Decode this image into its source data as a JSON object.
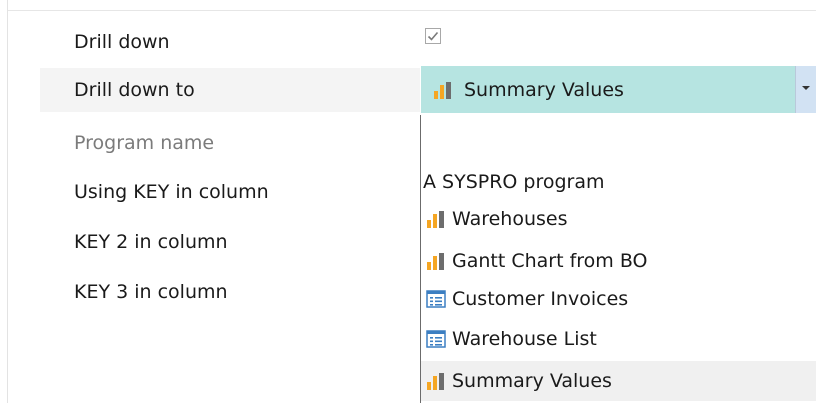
{
  "properties": [
    {
      "label": "Drill down",
      "disabled": false
    },
    {
      "label": "Drill down to",
      "disabled": false
    },
    {
      "label": "Program name",
      "disabled": true
    },
    {
      "label": "Using KEY in column",
      "disabled": false
    },
    {
      "label": "KEY 2 in column",
      "disabled": false
    },
    {
      "label": "KEY 3 in column",
      "disabled": false
    }
  ],
  "drill_down_checkbox": {
    "checked": true,
    "icon": "checkmark-icon"
  },
  "drill_down_to_combo": {
    "selected_value": "Summary Values",
    "selected_icon": "bar-chart-icon",
    "dropdown_icon": "chevron-down-icon",
    "background_color": "#b6e4e1"
  },
  "dropdown_options": [
    {
      "label": "",
      "icon": "none"
    },
    {
      "label": "A SYSPRO program",
      "icon": "none"
    },
    {
      "label": "Warehouses",
      "icon": "bar-chart-icon"
    },
    {
      "label": "Gantt Chart from BO",
      "icon": "bar-chart-icon"
    },
    {
      "label": "Customer Invoices",
      "icon": "list-view-icon"
    },
    {
      "label": "Warehouse List",
      "icon": "list-view-icon"
    },
    {
      "label": "Summary Values",
      "icon": "bar-chart-icon",
      "selected": true
    }
  ],
  "colors": {
    "bar_orange": "#f5a623",
    "bar_gray": "#6d6d6d",
    "list_icon_blue": "#3c7fc2",
    "disabled_text": "#7b7b7b"
  }
}
